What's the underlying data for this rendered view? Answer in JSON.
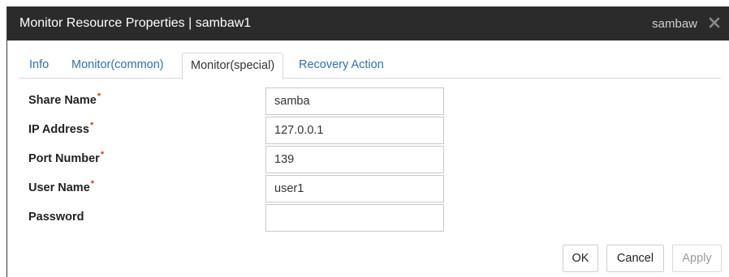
{
  "window": {
    "title": "Monitor Resource Properties | sambaw1",
    "resource_type": "sambaw",
    "close_icon": "close-icon"
  },
  "tabs": [
    {
      "label": "Info",
      "active": false
    },
    {
      "label": "Monitor(common)",
      "active": false
    },
    {
      "label": "Monitor(special)",
      "active": true
    },
    {
      "label": "Recovery Action",
      "active": false
    }
  ],
  "form": {
    "share_name": {
      "label": "Share Name",
      "required": "*",
      "value": "samba"
    },
    "ip_address": {
      "label": "IP Address",
      "required": "*",
      "value": "127.0.0.1"
    },
    "port_number": {
      "label": "Port Number",
      "required": "*",
      "value": "139"
    },
    "user_name": {
      "label": "User Name",
      "required": "*",
      "value": "user1"
    },
    "password": {
      "label": "Password",
      "value": ""
    }
  },
  "buttons": {
    "ok": "OK",
    "cancel": "Cancel",
    "apply": "Apply"
  },
  "colors": {
    "titlebar": "#2b2b2b",
    "tab_link": "#2f6fb6",
    "required_mark": "#d0402b"
  }
}
